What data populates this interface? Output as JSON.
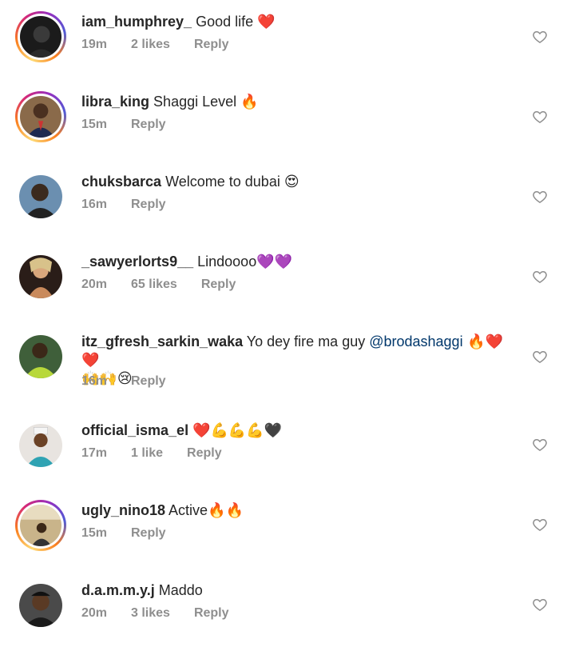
{
  "comments": [
    {
      "username": "iam_humphrey_",
      "text": "Good life ",
      "emoji": "❤️",
      "time": "19m",
      "likes": "2 likes",
      "reply": "Reply"
    },
    {
      "username": "libra_king",
      "text": "Shaggi Level ",
      "emoji": "🔥",
      "time": "15m",
      "likes": "",
      "reply": "Reply"
    },
    {
      "username": "chuksbarca",
      "text": "Welcome to dubai ",
      "emoji": "😍",
      "time": "16m",
      "likes": "",
      "reply": "Reply"
    },
    {
      "username": "_sawyerlorts9__",
      "text": "Lindoooo",
      "emoji": "💜💜",
      "time": "20m",
      "likes": "65 likes",
      "reply": "Reply"
    },
    {
      "username": "itz_gfresh_sarkin_waka",
      "text": "Yo dey fire ma guy ",
      "mention": "@brodashaggi",
      "emoji": " 🔥❤️❤️",
      "emoji_line2": "🙌🙌😢",
      "time": "16m",
      "likes": "",
      "reply": "Reply"
    },
    {
      "username": "official_isma_el",
      "text": "",
      "emoji": "❤️💪💪💪🖤",
      "time": "17m",
      "likes": "1 like",
      "reply": "Reply"
    },
    {
      "username": "ugly_nino18",
      "text": "Active",
      "emoji": "🔥🔥",
      "time": "15m",
      "likes": "",
      "reply": "Reply"
    },
    {
      "username": "d.a.m.m.y.j",
      "text": "Maddo",
      "emoji": "",
      "time": "20m",
      "likes": "3 likes",
      "reply": "Reply"
    }
  ],
  "colors": {
    "username": "#262626",
    "meta": "#8e8e8e",
    "mention": "#00376b",
    "heart_outline": "#8e8e8e"
  },
  "icons": {
    "like": "heart-outline-icon"
  }
}
